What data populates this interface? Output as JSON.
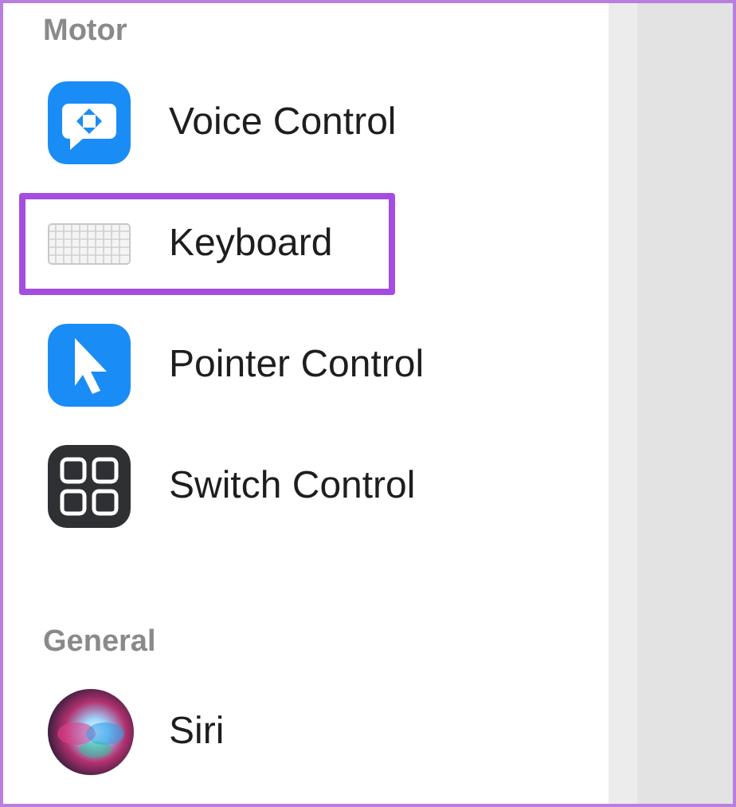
{
  "sections": [
    {
      "title": "Motor",
      "items": [
        {
          "label": "Voice Control",
          "kind": "voice",
          "highlighted": false
        },
        {
          "label": "Keyboard",
          "kind": "keyboard",
          "highlighted": true
        },
        {
          "label": "Pointer Control",
          "kind": "pointer",
          "highlighted": false
        },
        {
          "label": "Switch Control",
          "kind": "switch",
          "highlighted": false
        }
      ]
    },
    {
      "title": "General",
      "items": [
        {
          "label": "Siri",
          "kind": "siri",
          "highlighted": false
        }
      ]
    }
  ]
}
